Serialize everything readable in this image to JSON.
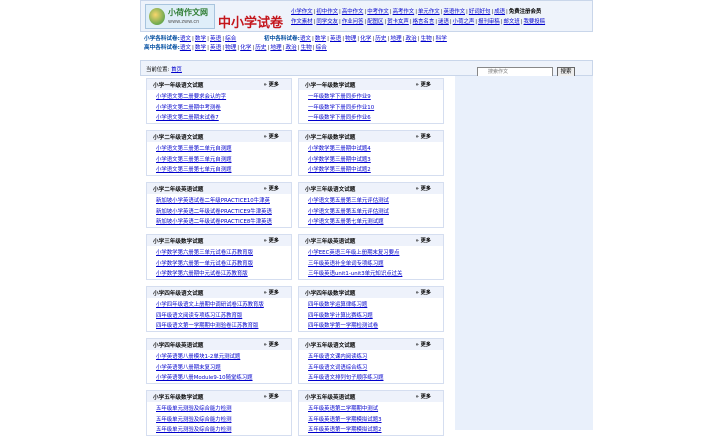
{
  "header": {
    "brand": "小荷作文网",
    "url": "www.zww.cn",
    "site_title_main": "中小学试卷",
    "topnav_rows": [
      [
        "小学作文",
        "初中作文",
        "高中作文",
        "中考作文",
        "高考作文",
        "单元作文",
        "英语作文",
        "好词好句",
        "成语",
        "免费注册会员"
      ],
      [
        "作文素材",
        "同学交友",
        "作业问答",
        "配图区",
        "贺卡女声",
        "格言名言",
        "谜语",
        "小荷之声",
        "报刊审稿",
        "邮文班",
        "我要投稿"
      ]
    ]
  },
  "categories": {
    "row1": [
      {
        "label": "小学各科试卷:",
        "items": [
          "语文",
          "数学",
          "英语",
          "综合"
        ]
      },
      {
        "label": "初中各科试卷:",
        "items": [
          "语文",
          "数学",
          "英语",
          "物理",
          "化学",
          "历史",
          "地理",
          "政治",
          "生物",
          "科学"
        ]
      }
    ],
    "row2": [
      {
        "label": "高中各科试卷:",
        "items": [
          "语文",
          "数学",
          "英语",
          "物理",
          "化学",
          "历史",
          "地理",
          "政治",
          "生物",
          "综合"
        ]
      }
    ]
  },
  "location": {
    "label": "当前位置:",
    "link": "首页",
    "search_placeholder": "搜索作文",
    "search_button": "搜索"
  },
  "more_label": "» 更多",
  "panels": [
    {
      "title": "小学一年级语文试题",
      "items": [
        "小学语文第二册要求会认的字",
        "小学语文第二册期中考测卷",
        "小学语文第二册期末试卷7"
      ]
    },
    {
      "title": "小学一年级数学试题",
      "items": [
        "一年级数学下册同步作业9",
        "一年级数学下册同步作业10",
        "一年级数学下册同步作业6"
      ]
    },
    {
      "title": "小学二年级语文试题",
      "items": [
        "小学语文第三册第二单元自测题",
        "小学语文第三册第三单元自测题",
        "小学语文第三册第七单元自测题"
      ]
    },
    {
      "title": "小学二年级数学试题",
      "items": [
        "小学数学第三册期中试题4",
        "小学数学第三册期中试题3",
        "小学数学第三册期中试题2"
      ]
    },
    {
      "title": "小学二年级英语试题",
      "items": [
        "新加坡小学英语试卷二年级PRACTICE10牛津英",
        "新加坡小学英语二年级试卷PRACTICE9牛津英语",
        "新加坡小学英语二年级试卷PRACTICE8牛津英语"
      ]
    },
    {
      "title": "小学三年级语文试题",
      "items": [
        "小学语文第五册第三单元评估测试",
        "小学语文第五册第五单元评估测试",
        "小学语文第五册第七单元测试题"
      ]
    },
    {
      "title": "小学三年级数学试题",
      "items": [
        "小学数学第六册第三单元试卷江苏教育版",
        "小学数学第六册第一单元试卷江苏教育版",
        "小学数学第六册期中元试卷江苏教育版"
      ]
    },
    {
      "title": "小学三年级英语试题",
      "items": [
        "小学EEC英语三年级上册期末复习要点",
        "三年级英语补全单词专项练习题",
        "三年级英语unit1-unit3单元知识点过关"
      ]
    },
    {
      "title": "小学四年级语文试题",
      "items": [
        "小学四年级语文上册期中调研试卷江苏教育版",
        "四年级语文阅读专项练习江苏教育版",
        "四年级语文第一学期期中测验卷江苏教育版"
      ]
    },
    {
      "title": "小学四年级数学试题",
      "items": [
        "四年级数学运算律练习题",
        "四年级数学计算比赛练习题",
        "四年级数学第一学期检测试卷"
      ]
    },
    {
      "title": "小学四年级英语试题",
      "items": [
        "小学英语第八册模块1-2单元测试题",
        "小学英语第八册期末复习题",
        "小学英语第八册Module9-10随堂练习题"
      ]
    },
    {
      "title": "小学五年级语文试题",
      "items": [
        "五年级语文课内阅读练习",
        "五年级语文词语综合练习",
        "五年级语文排列句子顺序练习题"
      ]
    },
    {
      "title": "小学五年级数学试题",
      "items": [
        "五年级单元测验及综合能力检测",
        "五年级单元测验及综合能力检测",
        "五年级单元测验及综合能力检测"
      ]
    },
    {
      "title": "小学五年级英语试题",
      "items": [
        "五年级英语第二学期期中测试",
        "五年级英语第一学期模拟试题3",
        "五年级英语第一学期模拟试题2"
      ]
    }
  ]
}
